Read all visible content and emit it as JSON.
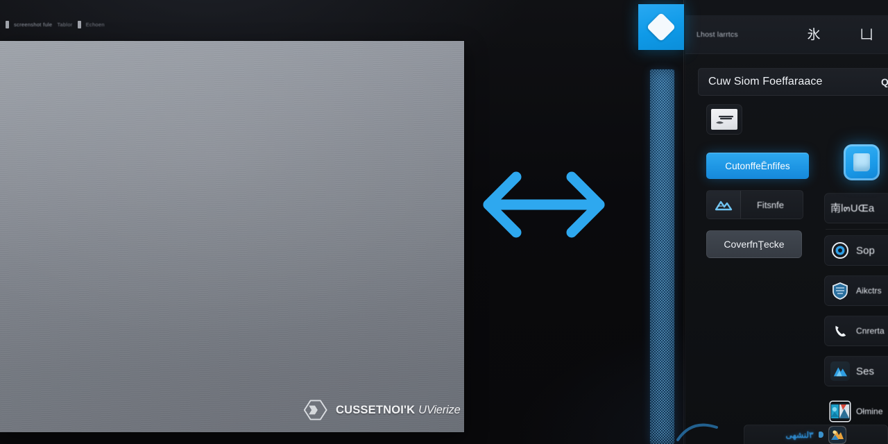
{
  "breadcrumb": {
    "mark": "▌",
    "segment1": "screenshot fule",
    "segment2": "Tablor",
    "separator": "▌",
    "segment3": "Echoen"
  },
  "canvas": {
    "watermark_title": "CUSSETNOI'K",
    "watermark_subtitle": "UVierize",
    "logo_icon": "hexagon-logo-icon"
  },
  "center": {
    "arrow_icon": "double-headed-horizontal-arrow-icon",
    "arrow_color": "#2ea8ef"
  },
  "strip": {
    "name": "dithered-texture-strip",
    "color": "#1d4a70",
    "accent": "#78bee b"
  },
  "brand": {
    "icon": "diamond-logo-icon",
    "color": "#0f9ae8"
  },
  "app_header": {
    "title": "Lhost larrtcs",
    "icon1": "asterisk-glyph-icon",
    "icon1_glyph": "氷",
    "icon2": "save-glyph-icon",
    "icon2_glyph": "凵"
  },
  "title_card": {
    "text": "Cuw Siom Foeffaraace",
    "badge": "QƆ"
  },
  "thumbnail": {
    "name": "preview-thumbnail",
    "glyph": "⟍"
  },
  "actions": [
    {
      "name": "customize-entries-button",
      "label": "CutonffeĒnfifes",
      "kind": "primary"
    },
    {
      "name": "filter-split-button",
      "label": "Fitsnfe",
      "kind": "split",
      "icon": "mountains-icon"
    },
    {
      "name": "convert-interface-button",
      "label": "CoverfnŢeckе",
      "kind": "secondary"
    }
  ],
  "list_items": [
    {
      "name": "list-item-tags",
      "label": "南l๓UŒa",
      "icon": "tag-glyph-icon",
      "size": "lg"
    },
    {
      "name": "list-item-support",
      "label": "Sop",
      "icon": "target-icon",
      "size": "lg"
    },
    {
      "name": "list-item-attributes",
      "label": "Aikctrs",
      "icon": "shield-icon",
      "size": "sm"
    },
    {
      "name": "list-item-contacts",
      "label": "Cnrerta",
      "icon": "phone-icon",
      "size": "sm"
    },
    {
      "name": "list-item-sessions",
      "label": "Ses",
      "icon": "landscape-icon",
      "size": "lg"
    },
    {
      "name": "list-item-offline",
      "label": "Ołmine",
      "icon": "photo-icon",
      "size": "sm"
    }
  ],
  "feature": {
    "name": "featured-app-icon",
    "icon": "app-tile-icon"
  },
  "bottom_card": {
    "text": "٣لنشهى",
    "icon": "app-badge-icon"
  },
  "colors": {
    "accent_blue": "#1e96e4",
    "bright_blue": "#2ea8ef",
    "panel_bg": "#121418",
    "canvas_gray": "#888d96",
    "text_primary": "#eef1f5",
    "text_muted": "#9aa0ab"
  }
}
